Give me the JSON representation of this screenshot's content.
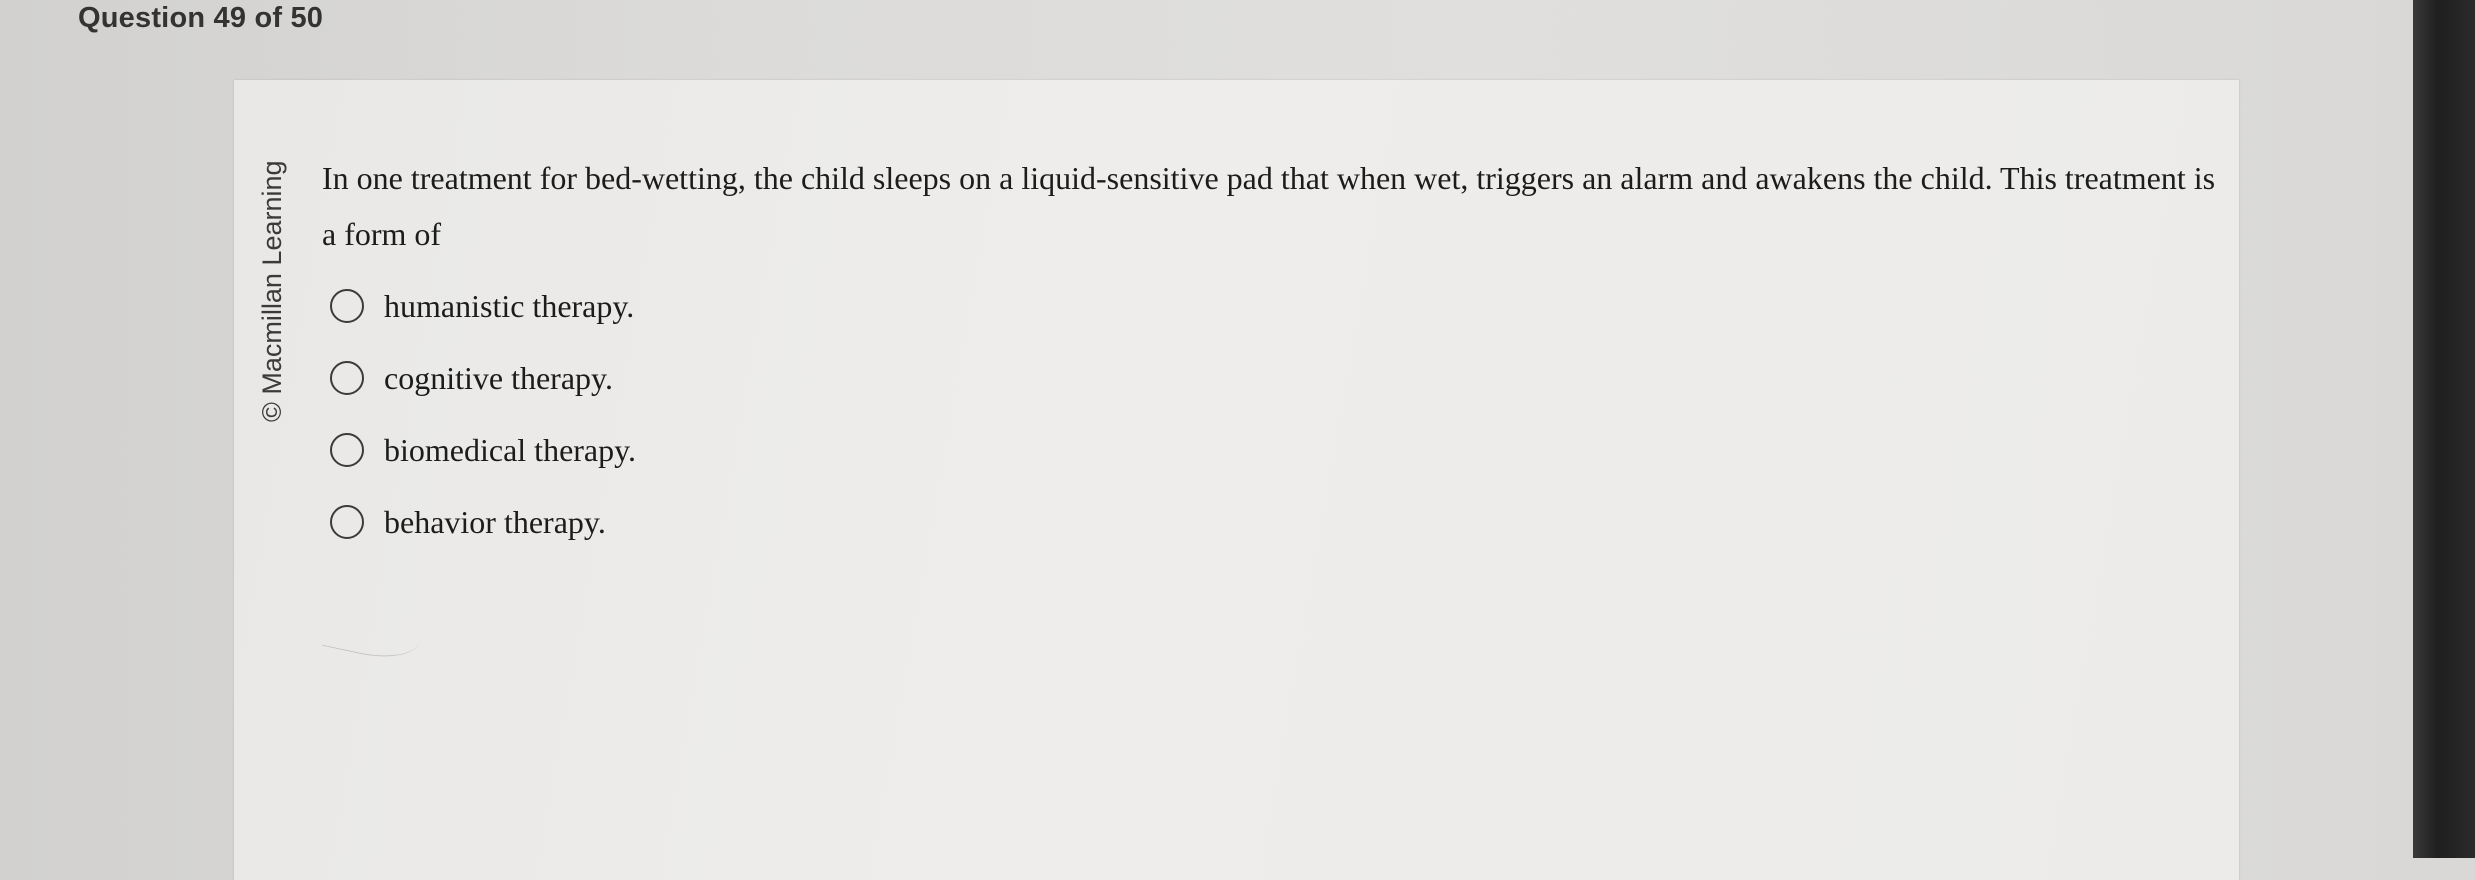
{
  "header": {
    "question_counter": "Question 49 of 50"
  },
  "sidebar": {
    "copyright": "© Macmillan Learning"
  },
  "question": {
    "stem": "In one treatment for bed-wetting, the child sleeps on a liquid-sensitive pad that when wet, triggers an alarm and awakens the child. This treatment is a form of",
    "options": [
      {
        "label": "humanistic therapy.",
        "selected": false
      },
      {
        "label": "cognitive therapy.",
        "selected": false
      },
      {
        "label": "biomedical therapy.",
        "selected": false
      },
      {
        "label": "behavior therapy.",
        "selected": false
      }
    ]
  },
  "icons": {
    "radio": "radio-button-icon"
  }
}
